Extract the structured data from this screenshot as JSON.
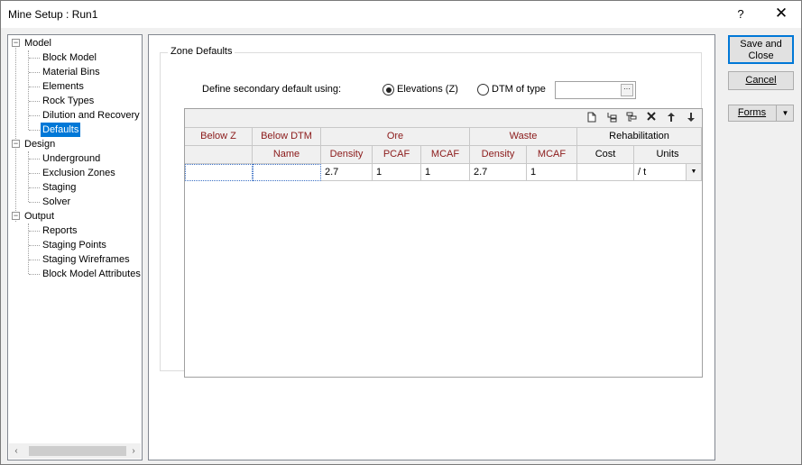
{
  "window": {
    "title": "Mine Setup : Run1",
    "help_glyph": "?",
    "close_glyph": "✕"
  },
  "tree": {
    "sections": [
      {
        "label": "Model",
        "children": [
          "Block Model",
          "Material Bins",
          "Elements",
          "Rock Types",
          "Dilution and Recovery",
          "Defaults"
        ]
      },
      {
        "label": "Design",
        "children": [
          "Underground",
          "Exclusion Zones",
          "Staging",
          "Solver"
        ]
      },
      {
        "label": "Output",
        "children": [
          "Reports",
          "Staging Points",
          "Staging Wireframes",
          "Block Model Attributes"
        ]
      }
    ],
    "selected": "Defaults",
    "expander_glyph": "−",
    "scroll_left": "‹",
    "scroll_right": "›"
  },
  "zone_defaults": {
    "group_label": "Zone Defaults",
    "define_label": "Define secondary default using:",
    "radio_elevations": "Elevations (Z)",
    "radio_dtm": "DTM of type",
    "selected_option": "Elevations (Z)",
    "dtm_value": ""
  },
  "grid": {
    "toolbar_icons": [
      "new-row-icon",
      "insert-row-icon",
      "append-row-icon",
      "delete-row-icon",
      "move-up-icon",
      "move-down-icon"
    ],
    "header_row1": {
      "below_z": "Below Z",
      "below_dtm": "Below DTM",
      "ore": "Ore",
      "waste": "Waste",
      "rehabilitation": "Rehabilitation"
    },
    "header_row2": {
      "name": "Name",
      "ore_density": "Density",
      "ore_pcaf": "PCAF",
      "ore_mcaf": "MCAF",
      "waste_density": "Density",
      "waste_mcaf": "MCAF",
      "cost": "Cost",
      "units": "Units"
    },
    "rows": [
      {
        "below_z": "",
        "below_dtm": "",
        "ore_density": "2.7",
        "ore_pcaf": "1",
        "ore_mcaf": "1",
        "waste_density": "2.7",
        "waste_mcaf": "1",
        "cost": "",
        "units": "/ t"
      }
    ]
  },
  "buttons": {
    "save_close": "Save and Close",
    "cancel": "Cancel",
    "forms": "Forms"
  }
}
